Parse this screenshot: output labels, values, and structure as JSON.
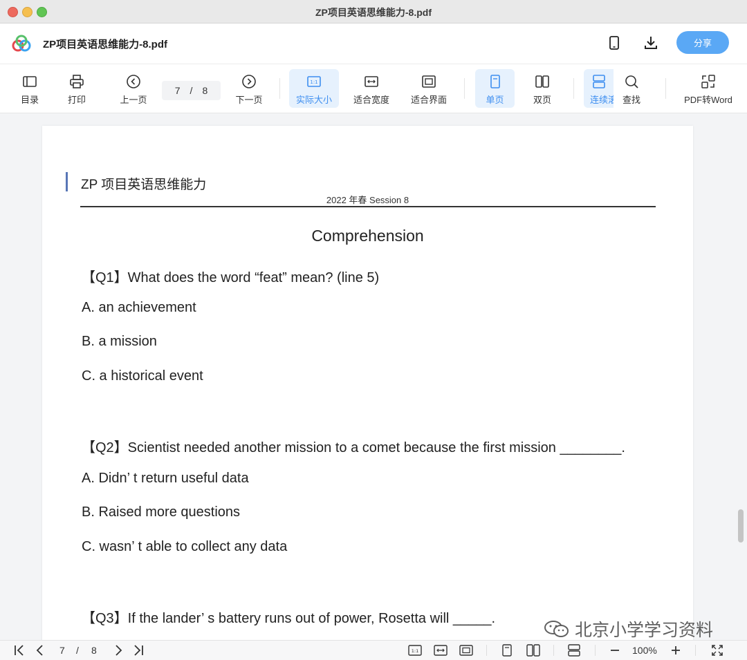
{
  "window": {
    "title": "ZP项目英语思维能力-8.pdf"
  },
  "header": {
    "doc_name": "ZP项目英语思维能力-8.pdf",
    "share_label": "分享",
    "icons": [
      "phone-icon",
      "download-icon"
    ]
  },
  "toolbar": {
    "toc": "目录",
    "print": "打印",
    "prev": "上一页",
    "page_current": "7",
    "page_sep": "/",
    "page_total": "8",
    "next": "下一页",
    "actual_size": "实际大小",
    "fit_width": "适合宽度",
    "fit_page": "适合界面",
    "single": "单页",
    "double": "双页",
    "continuous": "连续滚",
    "find": "查找",
    "pdf_to_word": "PDF转Word"
  },
  "document": {
    "heading": "ZP 项目英语思维能力",
    "subheading": "2022 年春  Session 8",
    "section_title": "Comprehension",
    "q1": "【Q1】What does the word  “feat”  mean? (line 5)",
    "q1_options": [
      "A.  an achievement",
      "B.  a mission",
      "C.  a historical event"
    ],
    "q2": "【Q2】Scientist needed another mission to a comet because the first mission ________.",
    "q2_options": [
      "A.  Didn’  t return useful data",
      "B.  Raised more questions",
      "C.  wasn’  t able to collect any data"
    ],
    "q3": "【Q3】If the lander’  s battery runs out of power, Rosetta will _____.",
    "watermark": "北京小学学习资料"
  },
  "bottombar": {
    "page_current": "7",
    "page_sep": "/",
    "page_total": "8",
    "zoom": "100%"
  },
  "colors": {
    "accent": "#3d8ef0",
    "share_bg": "#5aa8f5",
    "active_bg": "#e6f1fd",
    "heading_bar": "#5876b6"
  }
}
